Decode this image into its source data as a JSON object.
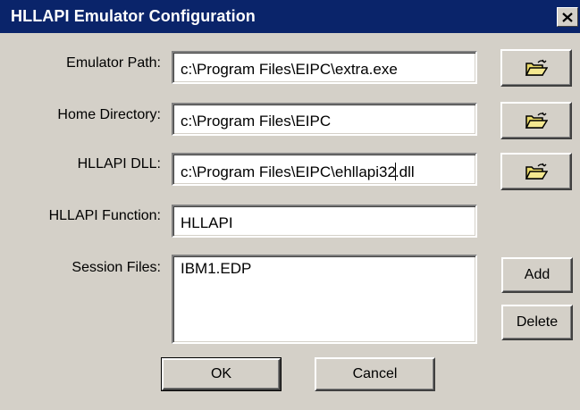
{
  "window": {
    "title": "HLLAPI Emulator Configuration",
    "close_icon": "close-icon"
  },
  "form": {
    "emulator_path": {
      "label": "Emulator Path:",
      "value": "c:\\Program Files\\EIPC\\extra.exe",
      "browse_icon": "open-folder-icon"
    },
    "home_directory": {
      "label": "Home Directory:",
      "value": "c:\\Program Files\\EIPC",
      "browse_icon": "open-folder-icon"
    },
    "hllapi_dll": {
      "label": "HLLAPI DLL:",
      "value_before_caret": "c:\\Program Files\\EIPC\\ehllapi32",
      "value_after_caret": ".dll",
      "browse_icon": "open-folder-icon"
    },
    "hllapi_function": {
      "label": "HLLAPI Function:",
      "value": "HLLAPI"
    },
    "session_files": {
      "label": "Session Files:",
      "items": [
        "IBM1.EDP"
      ],
      "add_label": "Add",
      "delete_label": "Delete"
    }
  },
  "buttons": {
    "ok_label": "OK",
    "cancel_label": "Cancel"
  },
  "colors": {
    "titlebar": "#0a246a",
    "face": "#d4d0c8",
    "folder": "#e8d868"
  }
}
